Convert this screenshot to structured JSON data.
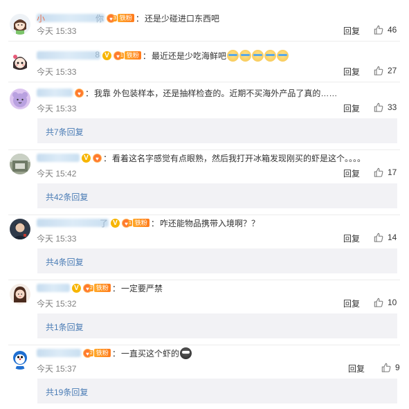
{
  "comments": [
    {
      "name_lead": "小",
      "name_tail": "你",
      "text": "还是少碰进口东西吧",
      "time": "今天 15:33",
      "reply_label": "回复",
      "likes": "46",
      "fan_label": "铁粉",
      "fan_level": "3",
      "emoji_count": 0,
      "replies_link": "",
      "verified": false
    },
    {
      "name_lead": "",
      "name_tail": "8",
      "text": "最近还是少吃海鲜吧",
      "time": "今天 15:33",
      "reply_label": "回复",
      "likes": "27",
      "fan_label": "铁粉",
      "fan_level": "1",
      "emoji_count": 5,
      "replies_link": "",
      "verified": true
    },
    {
      "name_lead": "",
      "name_tail": "",
      "text": "我靠 外包装样本，还是抽样检查的。近期不买海外产品了真的……",
      "time": "今天 15:33",
      "reply_label": "回复",
      "likes": "33",
      "fan_label": "",
      "fan_level": "",
      "emoji_count": 0,
      "replies_link": "共7条回复",
      "verified": false
    },
    {
      "name_lead": "",
      "name_tail": "",
      "text": "看着这名字感觉有点眼熟，然后我打开冰箱发现刚买的虾是这个。。。。",
      "time": "今天 15:42",
      "reply_label": "回复",
      "likes": "17",
      "fan_label": "",
      "fan_level": "",
      "emoji_count": 0,
      "replies_link": "共42条回复",
      "verified": true
    },
    {
      "name_lead": "",
      "name_tail": "了",
      "text": "咋还能物品携带入境啊？？",
      "time": "今天 15:33",
      "reply_label": "回复",
      "likes": "14",
      "fan_label": "铁粉",
      "fan_level": "1",
      "emoji_count": 0,
      "replies_link": "共4条回复",
      "verified": true
    },
    {
      "name_lead": "",
      "name_tail": "",
      "text": "一定要严禁",
      "time": "今天 15:32",
      "reply_label": "回复",
      "likes": "10",
      "fan_label": "铁粉",
      "fan_level": "2",
      "emoji_count": 0,
      "replies_link": "共1条回复",
      "verified": true
    },
    {
      "name_lead": "",
      "name_tail": "",
      "text": "一直买这个虾的",
      "time": "今天 15:37",
      "reply_label": "回复",
      "likes": "9",
      "fan_label": "铁粉",
      "fan_level": "2",
      "emoji_count": 1,
      "replies_link": "共19条回复",
      "verified": false
    }
  ],
  "colors": {
    "link": "#4a7cb5",
    "meta": "#808080",
    "reply_bg": "#f2f2f5",
    "fan_badge": "#ff8f22",
    "verified": "#f7b500"
  },
  "icons": {
    "like": "thumbs-up-icon",
    "verified": "v-badge-icon",
    "fan": "fan-badge-icon"
  }
}
